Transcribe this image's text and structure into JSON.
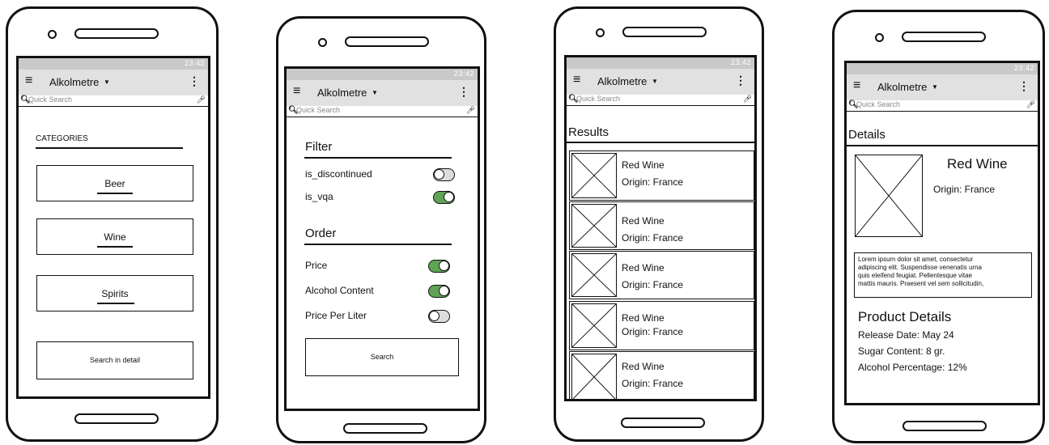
{
  "colors": {
    "toggle_on": "#5fa455",
    "appbar": "#e1e1e1",
    "statusbar": "#c9c9c9"
  },
  "common": {
    "status_time": "23:42",
    "app_title": "Alkolmetre",
    "menu_icon": "hamburger-menu-icon",
    "overflow_icon": "more-vertical-icon",
    "search_placeholder": "Quick Search"
  },
  "categories_screen": {
    "heading": "CATEGORIES",
    "items": [
      {
        "label": "Beer"
      },
      {
        "label": "Wine"
      },
      {
        "label": "Spirits"
      }
    ],
    "search_detail_label": "Search in detail"
  },
  "filter_screen": {
    "filter_heading": "Filter",
    "filters": [
      {
        "label": "is_discontinued",
        "on": false
      },
      {
        "label": "is_vqa",
        "on": true
      }
    ],
    "order_heading": "Order",
    "orders": [
      {
        "label": "Price",
        "on": true
      },
      {
        "label": "Alcohol Content",
        "on": true
      },
      {
        "label": "Price Per Liter",
        "on": false
      }
    ],
    "search_label": "Search"
  },
  "results_screen": {
    "heading": "Results",
    "items": [
      {
        "name": "Red Wine",
        "origin": "Origin: France"
      },
      {
        "name": "Red Wine",
        "origin": "Origin: France"
      },
      {
        "name": "Red Wine",
        "origin": "Origin: France"
      },
      {
        "name": "Red Wine",
        "origin": "Origin: France"
      },
      {
        "name": "Red Wine",
        "origin": "Origin: France"
      }
    ]
  },
  "details_screen": {
    "heading": "Details",
    "name": "Red Wine",
    "origin": "Origin: France",
    "description_lines": [
      "Lorem ipsum dolor sit amet, consectetur",
      "adipiscing elit. Suspendisse venenatis urna",
      "quis eleifend feugiat. Pellentesque vitae",
      "mattis mauris. Praesent vel sem sollicitudin,"
    ],
    "product_details_heading": "Product Details",
    "release_date": "Release Date: May 24",
    "sugar_content": "Sugar Content: 8 gr.",
    "alcohol_percentage": "Alcohol Percentage: 12%"
  }
}
